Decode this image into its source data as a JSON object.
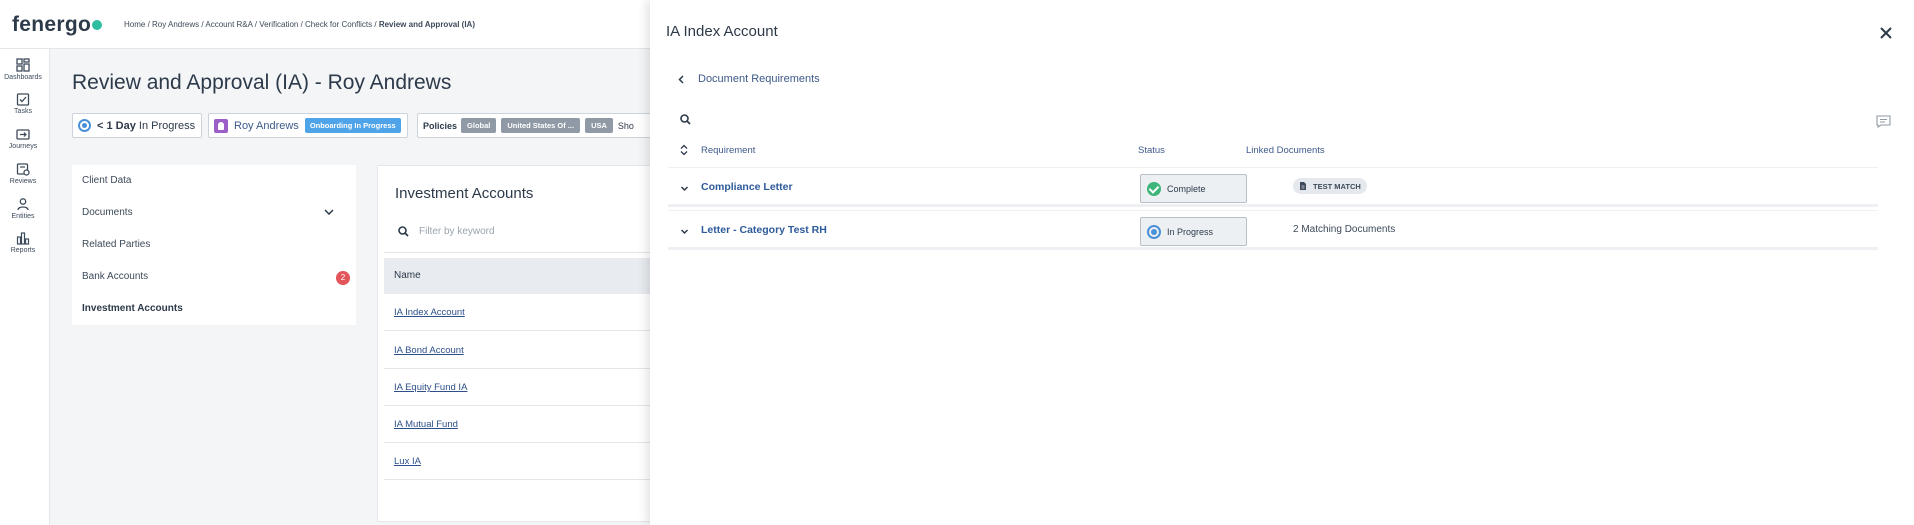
{
  "app": {
    "logo": "fenergo"
  },
  "breadcrumb": {
    "items": [
      "Home",
      "Roy Andrews",
      "Account R&A",
      "Verification",
      "Check for Conflicts"
    ],
    "current": "Review and Approval (IA)",
    "separator": " / "
  },
  "rail": {
    "items": [
      {
        "label": "Dashboards",
        "icon": "dashboard-icon"
      },
      {
        "label": "Tasks",
        "icon": "tasks-icon"
      },
      {
        "label": "Journeys",
        "icon": "journeys-icon"
      },
      {
        "label": "Reviews",
        "icon": "reviews-icon"
      },
      {
        "label": "Entities",
        "icon": "entities-icon"
      },
      {
        "label": "Reports",
        "icon": "reports-icon"
      }
    ]
  },
  "page": {
    "title": "Review and Approval (IA) - Roy Andrews"
  },
  "summary": {
    "sla_value": "< 1 Day",
    "sla_status": "In Progress",
    "entity_name": "Roy Andrews",
    "entity_badge": "Onboarding In Progress",
    "policies_label": "Policies",
    "policies": [
      "Global",
      "United States Of ...",
      "USA"
    ],
    "truncated_more": "Sho"
  },
  "leftnav": {
    "items": [
      {
        "label": "Client Data"
      },
      {
        "label": "Documents"
      },
      {
        "label": "Related Parties"
      },
      {
        "label": "Bank Accounts"
      },
      {
        "label": "Investment Accounts"
      }
    ],
    "bank_accounts_count": "2"
  },
  "investment": {
    "title": "Investment Accounts",
    "search_placeholder": "Filter by keyword",
    "column_name": "Name",
    "rows": [
      "IA Index Account",
      "IA Bond Account",
      "IA Equity Fund IA",
      "IA Mutual Fund",
      "Lux IA"
    ]
  },
  "panel": {
    "title": "IA Index Account",
    "back_label": "Document Requirements",
    "columns": {
      "requirement": "Requirement",
      "status": "Status",
      "linked": "Linked Documents"
    },
    "requirements": [
      {
        "name": "Compliance Letter",
        "status": "Complete",
        "linked": "TEST MATCH"
      },
      {
        "name": "Letter - Category Test RH",
        "status": "In Progress",
        "linked": "2 Matching Documents"
      }
    ]
  },
  "colors": {
    "accent": "#2fbfa0",
    "link": "#2d5a9a",
    "complete": "#3fb57a",
    "in_progress": "#4a90d9",
    "badge_blue": "#4fa3e8",
    "alert": "#e2555a",
    "avatar": "#9b5fc7"
  }
}
